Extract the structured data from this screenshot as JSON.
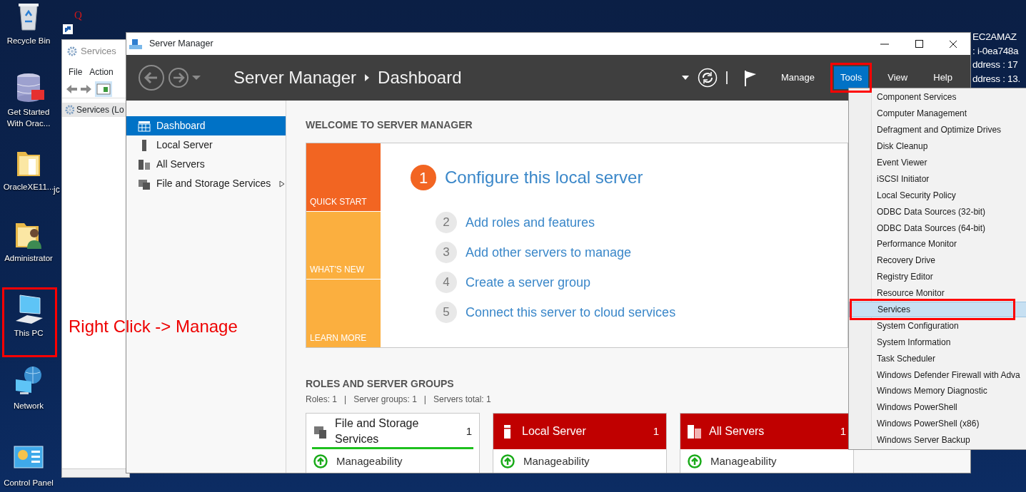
{
  "desktop_icons": [
    {
      "label": "Recycle Bin",
      "kind": "recycle",
      "highlighted": false
    },
    {
      "label": "Get Started With Orac...",
      "kind": "database",
      "highlighted": false
    },
    {
      "label": "OracleXE11...",
      "kind": "folder",
      "highlighted": false
    },
    {
      "label": "Administrator",
      "kind": "user-folder",
      "highlighted": false
    },
    {
      "label": "This PC",
      "kind": "computer",
      "highlighted": true
    },
    {
      "label": "Network",
      "kind": "network",
      "highlighted": false
    },
    {
      "label": "Control Panel",
      "kind": "control-panel",
      "highlighted": false
    }
  ],
  "desktop_fragments": [
    "Q",
    "jc"
  ],
  "annotation": {
    "text": "Right Click -> Manage"
  },
  "system_info": [
    "EC2AMAZ",
    ": i-0ea748a",
    "ddress : 17",
    "ddress : 13."
  ],
  "services_window": {
    "title": "Services",
    "menu": [
      "File",
      "Action"
    ],
    "tree_item": "Services (Lo"
  },
  "server_manager": {
    "title": "Server Manager",
    "breadcrumb": [
      "Server Manager",
      "Dashboard"
    ],
    "menu": [
      {
        "label": "Manage",
        "selected": false,
        "highlighted": false
      },
      {
        "label": "Tools",
        "selected": true,
        "highlighted": true
      },
      {
        "label": "View",
        "selected": false,
        "highlighted": false
      },
      {
        "label": "Help",
        "selected": false,
        "highlighted": false
      }
    ],
    "nav": [
      {
        "label": "Dashboard",
        "kind": "dashboard",
        "selected": true,
        "expandable": false
      },
      {
        "label": "Local Server",
        "kind": "server",
        "selected": false,
        "expandable": false
      },
      {
        "label": "All Servers",
        "kind": "servers",
        "selected": false,
        "expandable": false
      },
      {
        "label": "File and Storage Services",
        "kind": "storage",
        "selected": false,
        "expandable": true
      }
    ],
    "welcome": {
      "heading": "WELCOME TO SERVER MANAGER",
      "tiles": [
        {
          "label": "QUICK START",
          "selected": true
        },
        {
          "label": "WHAT'S NEW",
          "selected": false
        },
        {
          "label": "LEARN MORE",
          "selected": false
        }
      ],
      "steps": [
        {
          "number": "1",
          "label": "Configure this local server",
          "selected": true
        },
        {
          "number": "2",
          "label": "Add roles and features",
          "selected": false
        },
        {
          "number": "3",
          "label": "Add other servers to manage",
          "selected": false
        },
        {
          "number": "4",
          "label": "Create a server group",
          "selected": false
        },
        {
          "number": "5",
          "label": "Connect this server to cloud services",
          "selected": false
        }
      ]
    },
    "roles": {
      "heading": "ROLES AND SERVER GROUPS",
      "summary": "Roles: 1   |   Server groups: 1   |   Servers total: 1",
      "cards": [
        {
          "title": "File and Storage Services",
          "kind": "storage",
          "count": "1",
          "alert": false,
          "status": "Manageability"
        },
        {
          "title": "Local Server",
          "kind": "server",
          "count": "1",
          "alert": true,
          "status": "Manageability"
        },
        {
          "title": "All Servers",
          "kind": "servers",
          "count": "1",
          "alert": true,
          "status": "Manageability"
        }
      ]
    }
  },
  "tools_menu": [
    {
      "label": "Component Services",
      "selected": false,
      "highlighted": false
    },
    {
      "label": "Computer Management",
      "selected": false,
      "highlighted": false
    },
    {
      "label": "Defragment and Optimize Drives",
      "selected": false,
      "highlighted": false
    },
    {
      "label": "Disk Cleanup",
      "selected": false,
      "highlighted": false
    },
    {
      "label": "Event Viewer",
      "selected": false,
      "highlighted": false
    },
    {
      "label": "iSCSI Initiator",
      "selected": false,
      "highlighted": false
    },
    {
      "label": "Local Security Policy",
      "selected": false,
      "highlighted": false
    },
    {
      "label": "ODBC Data Sources (32-bit)",
      "selected": false,
      "highlighted": false
    },
    {
      "label": "ODBC Data Sources (64-bit)",
      "selected": false,
      "highlighted": false
    },
    {
      "label": "Performance Monitor",
      "selected": false,
      "highlighted": false
    },
    {
      "label": "Recovery Drive",
      "selected": false,
      "highlighted": false
    },
    {
      "label": "Registry Editor",
      "selected": false,
      "highlighted": false
    },
    {
      "label": "Resource Monitor",
      "selected": false,
      "highlighted": false
    },
    {
      "label": "Services",
      "selected": true,
      "highlighted": true
    },
    {
      "label": "System Configuration",
      "selected": false,
      "highlighted": false
    },
    {
      "label": "System Information",
      "selected": false,
      "highlighted": false
    },
    {
      "label": "Task Scheduler",
      "selected": false,
      "highlighted": false
    },
    {
      "label": "Windows Defender Firewall with Adva",
      "selected": false,
      "highlighted": false
    },
    {
      "label": "Windows Memory Diagnostic",
      "selected": false,
      "highlighted": false
    },
    {
      "label": "Windows PowerShell",
      "selected": false,
      "highlighted": false
    },
    {
      "label": "Windows PowerShell (x86)",
      "selected": false,
      "highlighted": false
    },
    {
      "label": "Windows Server Backup",
      "selected": false,
      "highlighted": false
    }
  ]
}
